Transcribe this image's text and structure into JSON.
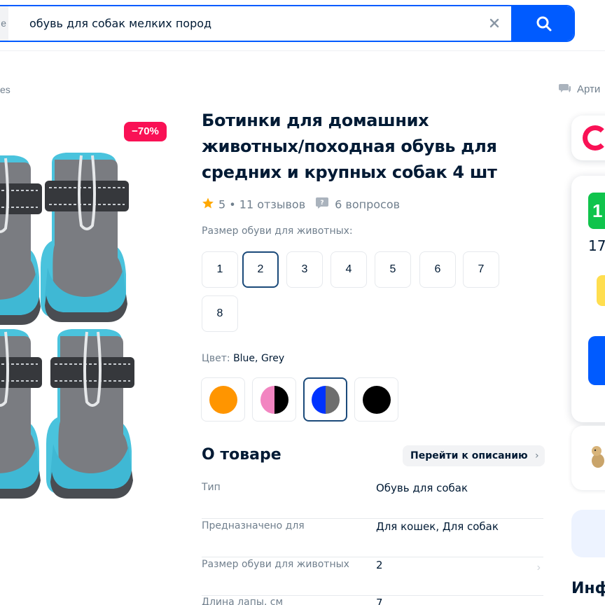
{
  "search": {
    "prefix_fragment": "e",
    "query": "обувь для собак мелких пород"
  },
  "breadcrumb": {
    "tail": "es"
  },
  "article": {
    "label": "Арти"
  },
  "gallery": {
    "discount": "−70%"
  },
  "product": {
    "title": "Ботинки для домашних животных/походная обувь для средних и крупных собак 4 шт",
    "rating": "5",
    "reviews": "11 отзывов",
    "questions": "6 вопросов"
  },
  "size": {
    "label": "Размер обуви для животных:",
    "options": [
      "1",
      "2",
      "3",
      "4",
      "5",
      "6",
      "7",
      "8"
    ],
    "selected": "2"
  },
  "color": {
    "label": "Цвет:",
    "value": "Blue, Grey",
    "swatches": [
      {
        "name": "orange",
        "colors": [
          "#ff9500"
        ]
      },
      {
        "name": "pink-black",
        "colors": [
          "#f285c1",
          "#000000"
        ]
      },
      {
        "name": "blue-grey",
        "colors": [
          "#0033ff",
          "#6e6e6e"
        ],
        "selected": true
      },
      {
        "name": "black",
        "colors": [
          "#000000"
        ]
      }
    ]
  },
  "about": {
    "title": "О товаре",
    "to_description": "Перейти к описанию",
    "specs": [
      {
        "key": "Тип",
        "value": "Обувь для собак"
      },
      {
        "key": "Предназначено для",
        "value": "Для кошек, Для собак"
      },
      {
        "key": "Размер обуви для животных",
        "value": "2"
      },
      {
        "key": "Длина лапы, см",
        "value": "7"
      }
    ]
  },
  "right_panel": {
    "price_badge": "1",
    "price_sub": "17",
    "info_heading": "Инф"
  },
  "colors": {
    "accent": "#005bff",
    "discount": "#f91155",
    "text": "#001a34",
    "muted": "#707f8d",
    "green": "#10c44c",
    "star": "#ffa800"
  }
}
